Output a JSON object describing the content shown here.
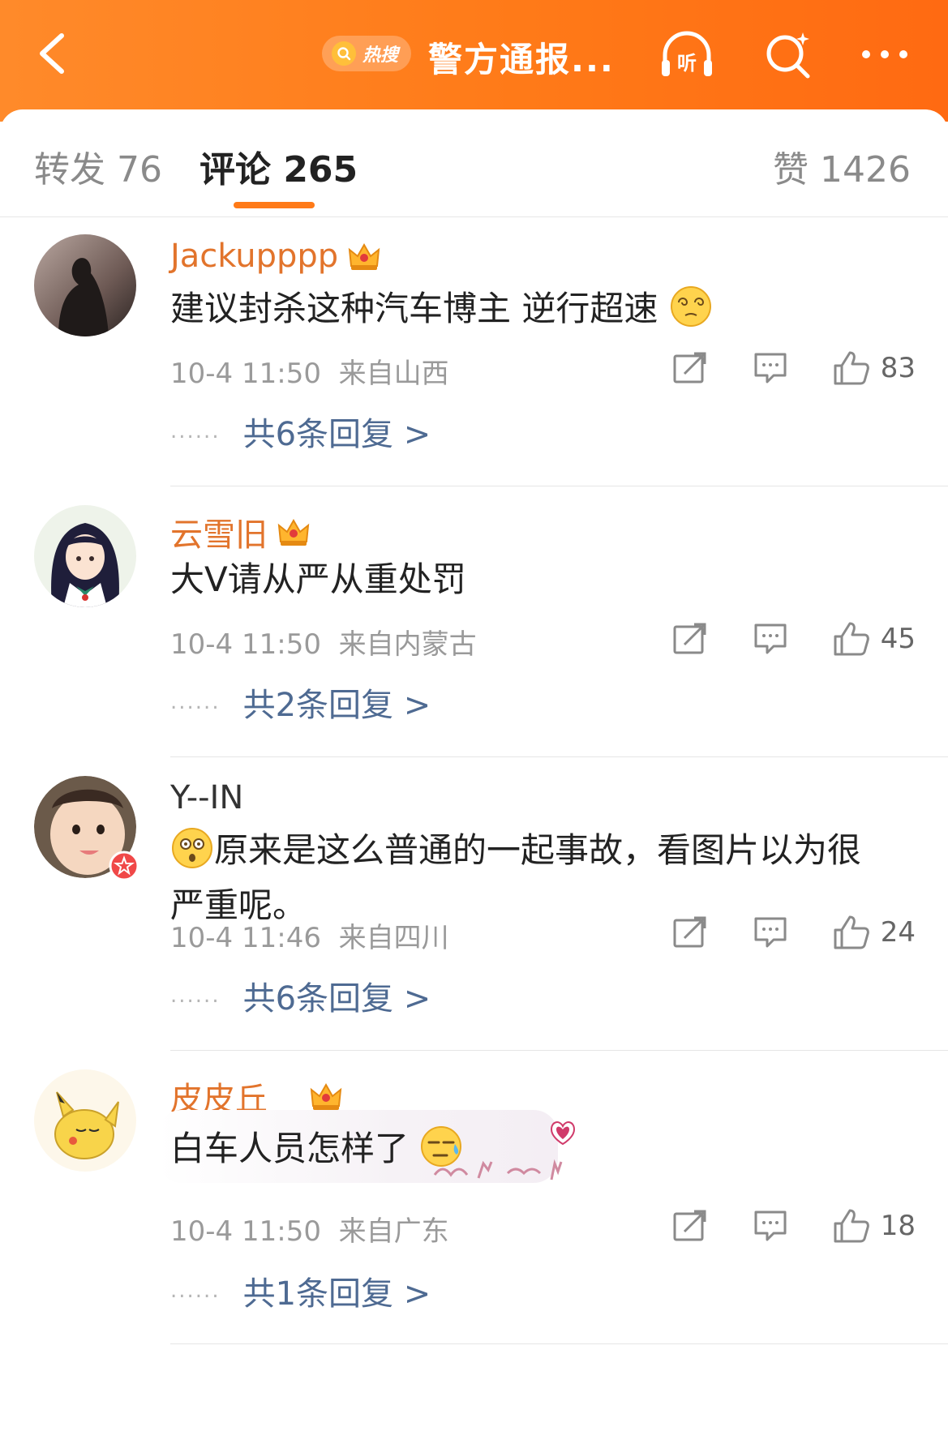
{
  "topbar": {
    "hot_label": "热搜",
    "title": "警方通报...",
    "listen_label": "听"
  },
  "tabs": {
    "repost": "转发 76",
    "comment": "评论 265",
    "like": "赞 1426"
  },
  "comments": [
    {
      "name": "Jackupppp",
      "text": "建议封杀这种汽车博主 逆行超速",
      "time": "10-4 11:50",
      "location": "来自山西",
      "likes": "83",
      "replies": "共6条回复 >"
    },
    {
      "name": "云雪旧",
      "text": "大V请从严从重处罚",
      "time": "10-4 11:50",
      "location": "来自内蒙古",
      "likes": "45",
      "replies": "共2条回复 >"
    },
    {
      "name": "Y--IN",
      "text_line1": "原来是这么普通的一起事故，看图片以为很",
      "text_line2": "严重呢。",
      "time": "10-4 11:46",
      "location": "来自四川",
      "likes": "24",
      "replies": "共6条回复 >"
    },
    {
      "name": "皮皮丘__",
      "text": "白车人员怎样了",
      "time": "10-4 11:50",
      "location": "来自广东",
      "likes": "18",
      "replies": "共1条回复 >"
    }
  ],
  "dots": "......",
  "colors": {
    "brand_orange": "#ff7a18",
    "name_orange": "#e2742c",
    "link_blue": "#4e6a92"
  }
}
